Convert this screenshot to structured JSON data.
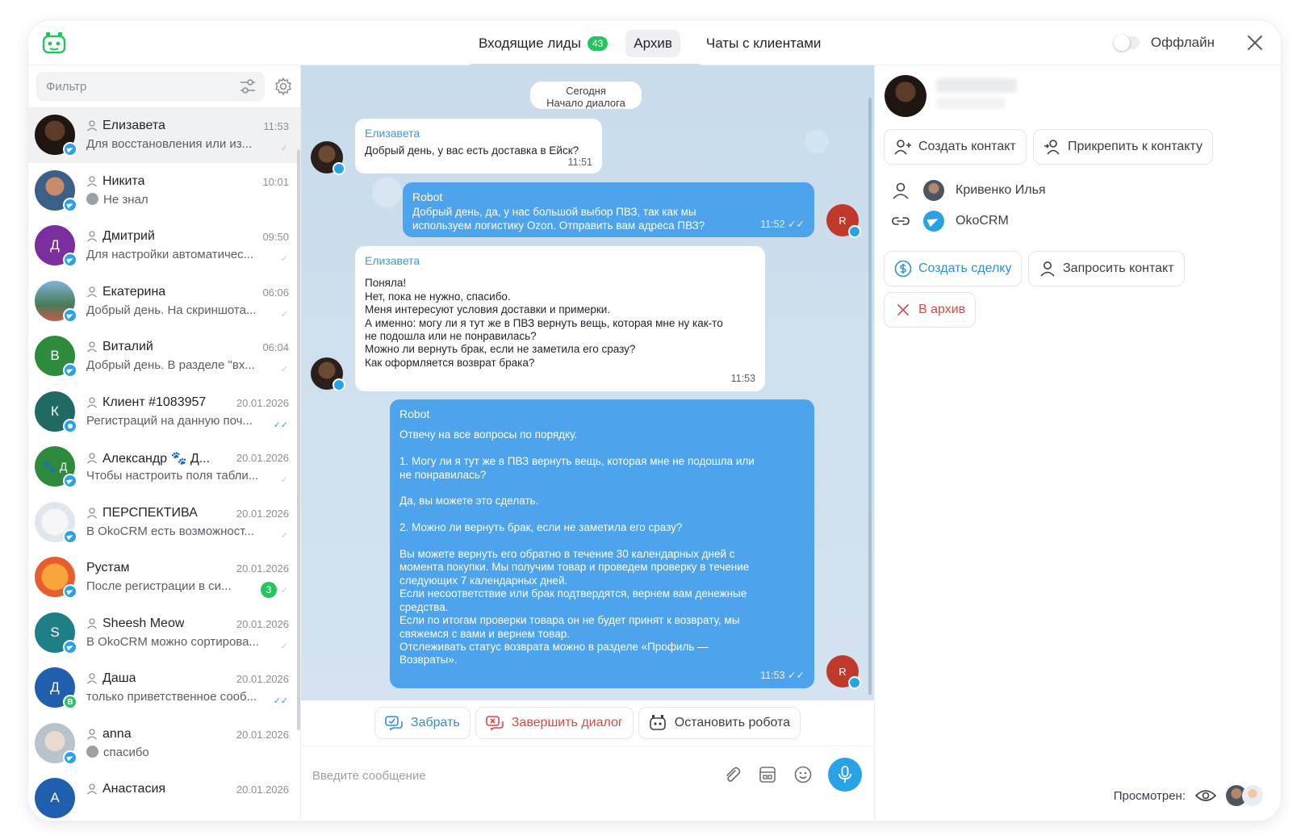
{
  "header": {
    "tabs": [
      {
        "label": "Входящие лиды",
        "count": "43"
      },
      {
        "label": "Архив"
      },
      {
        "label": "Чаты с клиентами"
      }
    ],
    "status_label": "Оффлайн"
  },
  "sidebar": {
    "filter_placeholder": "Фильтр",
    "chats": [
      {
        "name": "Елизавета",
        "time": "11:53",
        "preview": "Для восстановления или из..."
      },
      {
        "name": "Никита",
        "time": "10:01",
        "preview": "Не знал"
      },
      {
        "name": "Дмитрий",
        "time": "09:50",
        "preview": "Для настройки автоматичес...",
        "initial": "Д"
      },
      {
        "name": "Екатерина",
        "time": "06:06",
        "preview": "Добрый день. На скриншота..."
      },
      {
        "name": "Виталий",
        "time": "06:04",
        "preview": "Добрый день. В разделе \"вх...",
        "initial": "В"
      },
      {
        "name": "Клиент #1083957",
        "time": "20.01.2026",
        "preview": "Регистраций на данную поч...",
        "initial": "К"
      },
      {
        "name": "Александр 🐾 Д...",
        "time": "20.01.2026",
        "preview": "Чтобы настроить поля табли...",
        "initial": "🐾 Д"
      },
      {
        "name": "ПЕРСПЕКТИВА",
        "time": "20.01.2026",
        "preview": "В OkoCRM есть возможност..."
      },
      {
        "name": "Рустам",
        "time": "20.01.2026",
        "preview": "После регистрации в си...",
        "unread": "3"
      },
      {
        "name": "Sheesh Meow",
        "time": "20.01.2026",
        "preview": "В OkoCRM можно сортирова...",
        "initial": "S"
      },
      {
        "name": "Даша",
        "time": "20.01.2026",
        "preview": "только приветственное сооб...",
        "initial": "Д",
        "badge": "B"
      },
      {
        "name": "anna",
        "time": "20.01.2026",
        "preview": "спасибо"
      },
      {
        "name": "Анастасия",
        "time": "20.01.2026",
        "preview": "",
        "initial": "А"
      }
    ]
  },
  "conversation": {
    "date_label": "Сегодня",
    "start_label": "Начало диалога",
    "messages": [
      {
        "author": "Елизавета",
        "text": "Добрый день, у вас есть доставка в Ейск?",
        "time": "11:51"
      },
      {
        "author": "Robot",
        "text": "Добрый день, да, у нас большой выбор ПВЗ, так как мы\nиспользуем логистику Ozon. Отправить вам адреса ПВЗ?",
        "time": "11:52"
      },
      {
        "author": "Елизавета",
        "text": "Поняла!\nНет, пока не нужно, спасибо.\nМеня интересуют условия доставки и примерки.\nА именно: могу ли я тут же в ПВЗ вернуть вещь, которая мне ну как-то\nне подошла или не понравилась?\nМожно ли вернуть брак, если не заметила его сразу?\nКак оформляется возврат брака?",
        "time": "11:53"
      },
      {
        "author": "Robot",
        "text": "Отвечу на все вопросы по порядку.\n\n   1. Могу ли я тут же в ПВЗ вернуть вещь, которая мне не подошла или\n       не понравилась?\n\nДа, вы можете это сделать.\n\n   2. Можно ли вернуть брак, если не заметила его сразу?\n\nВы можете вернуть его обратно в течение 30 календарных дней с\nмомента покупки. Мы получим товар и проведем проверку в течение\nследующих 7 календарных дней.\nЕсли несоответствие или брак подтвердятся, вернем вам денежные\nсредства.\nЕсли по итогам проверки товара он не будет принят к возврату, мы\nсвяжемся с вами и вернем товар.\nОтслеживать статус возврата можно в разделе «Профиль —\nВозвраты».",
        "time": "11:53"
      }
    ],
    "robot_avatar": "R"
  },
  "actions": {
    "take": "Забрать",
    "finish": "Завершить диалог",
    "stop_robot": "Остановить робота"
  },
  "composer": {
    "placeholder": "Введите сообщение"
  },
  "contact_panel": {
    "create_contact": "Создать контакт",
    "attach_contact": "Прикрепить к контакту",
    "responsible": "Кривенко Илья",
    "channel": "OkoCRM",
    "create_deal": "Создать сделку",
    "request_contact": "Запросить контакт",
    "to_archive": "В архив",
    "viewed_label": "Просмотрен:"
  }
}
